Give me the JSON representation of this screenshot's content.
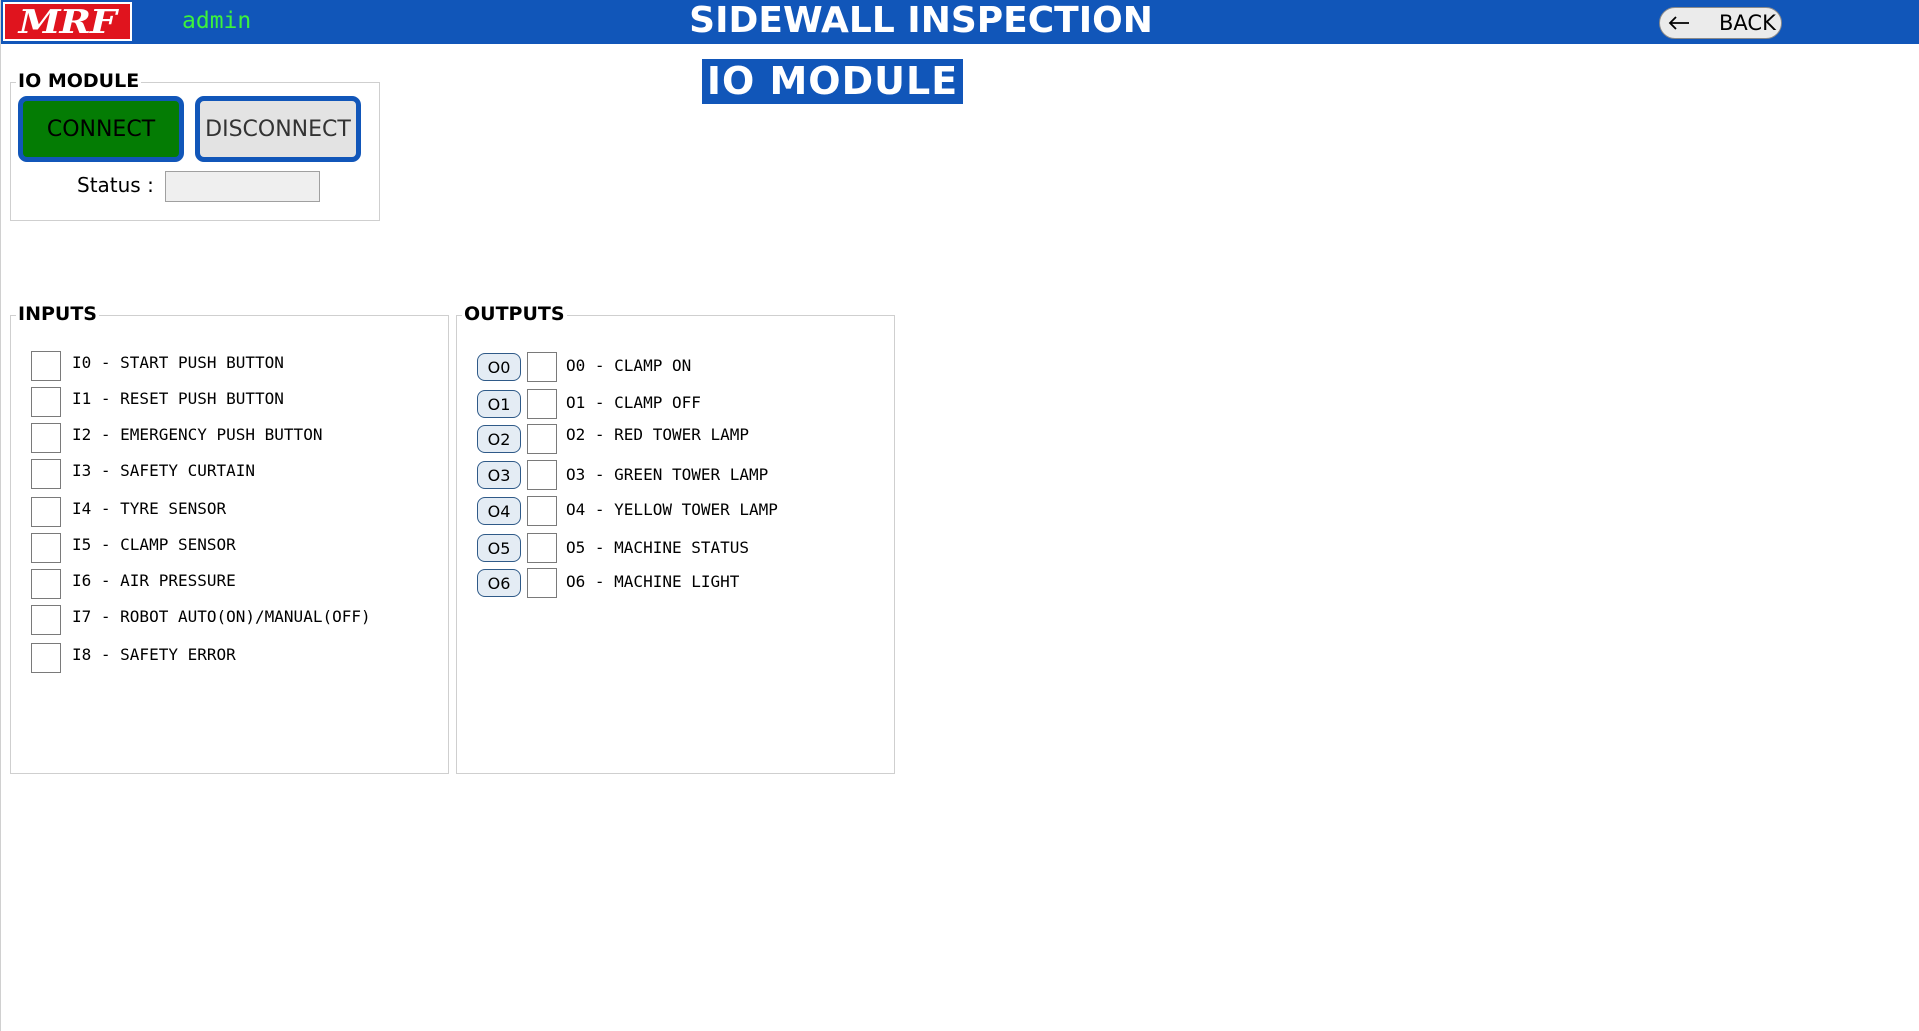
{
  "header": {
    "logo_text": "MRF",
    "username": "admin",
    "title": "SIDEWALL INSPECTION",
    "back_label": "BACK",
    "back_icon": "arrow-left-icon",
    "brand_color": "#1156b9",
    "logo_color": "#e0141e",
    "username_color": "#3cf23c"
  },
  "page_heading": "IO MODULE",
  "io_module": {
    "title": "IO MODULE",
    "connect_label": "CONNECT",
    "disconnect_label": "DISCONNECT",
    "status_label": "Status :",
    "status_value": "",
    "connect_color": "#047c04"
  },
  "inputs": {
    "title": "INPUTS",
    "items": [
      {
        "label": "I0 - START PUSH BUTTON",
        "checked": false
      },
      {
        "label": "I1 - RESET PUSH BUTTON",
        "checked": false
      },
      {
        "label": "I2 - EMERGENCY PUSH BUTTON",
        "checked": false
      },
      {
        "label": "I3 - SAFETY CURTAIN",
        "checked": false
      },
      {
        "label": "I4 - TYRE SENSOR",
        "checked": false
      },
      {
        "label": "I5 - CLAMP SENSOR",
        "checked": false
      },
      {
        "label": "I6 - AIR PRESSURE",
        "checked": false
      },
      {
        "label": "I7 - ROBOT AUTO(ON)/MANUAL(OFF)",
        "checked": false
      },
      {
        "label": "I8 - SAFETY ERROR",
        "checked": false
      }
    ]
  },
  "outputs": {
    "title": "OUTPUTS",
    "items": [
      {
        "button": "O0",
        "label": "O0 - CLAMP ON",
        "checked": false
      },
      {
        "button": "O1",
        "label": "O1 - CLAMP OFF",
        "checked": false
      },
      {
        "button": "O2",
        "label": "O2 - RED TOWER LAMP",
        "checked": false
      },
      {
        "button": "O3",
        "label": "O3 - GREEN TOWER LAMP",
        "checked": false
      },
      {
        "button": "O4",
        "label": "O4 - YELLOW TOWER LAMP",
        "checked": false
      },
      {
        "button": "O5",
        "label": "O5 - MACHINE STATUS",
        "checked": false
      },
      {
        "button": "O6",
        "label": "O6 - MACHINE LIGHT",
        "checked": false
      }
    ]
  }
}
